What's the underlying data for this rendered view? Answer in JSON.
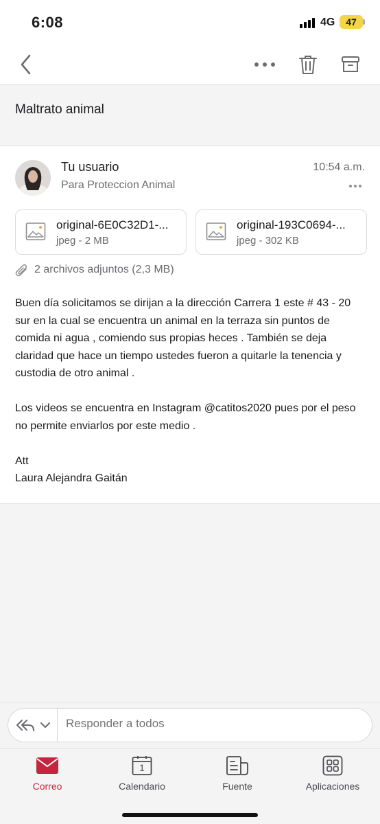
{
  "status_bar": {
    "time": "6:08",
    "network": "4G",
    "battery": "47"
  },
  "toolbar": {
    "back_icon": "chevron-left-icon",
    "more_icon": "ellipsis-icon",
    "trash_icon": "trash-icon",
    "archive_icon": "archive-icon"
  },
  "subject": "Maltrato animal",
  "message": {
    "sender": "Tu usuario",
    "recipient": "Para Proteccion Animal",
    "time": "10:54 a.m.",
    "attachments": [
      {
        "name": "original-6E0C32D1-...",
        "meta": "jpeg - 2 MB"
      },
      {
        "name": "original-193C0694-...",
        "meta": "jpeg - 302 KB"
      }
    ],
    "attachments_summary": "2 archivos adjuntos (2,3 MB)",
    "body": [
      "Buen día  solicitamos se dirijan a la dirección Carrera 1 este # 43 - 20 sur en la cual se encuentra un animal en la terraza sin puntos de comida ni agua , comiendo sus propias heces . También se deja claridad que hace un tiempo ustedes fueron a quitarle la tenencia y custodia de otro animal .",
      "Los videos se encuentra en Instagram @catitos2020 pues por el peso no permite enviarlos por este medio .",
      "Att",
      "Laura Alejandra Gaitán"
    ]
  },
  "reply": {
    "placeholder": "Responder a todos"
  },
  "tabs": [
    {
      "label": "Correo",
      "icon": "mail-icon",
      "active": true
    },
    {
      "label": "Calendario",
      "icon": "calendar-icon",
      "day": "1"
    },
    {
      "label": "Fuente",
      "icon": "feed-icon"
    },
    {
      "label": "Aplicaciones",
      "icon": "apps-grid-icon"
    }
  ],
  "colors": {
    "accent": "#c4273d",
    "battery": "#f4d54a"
  }
}
